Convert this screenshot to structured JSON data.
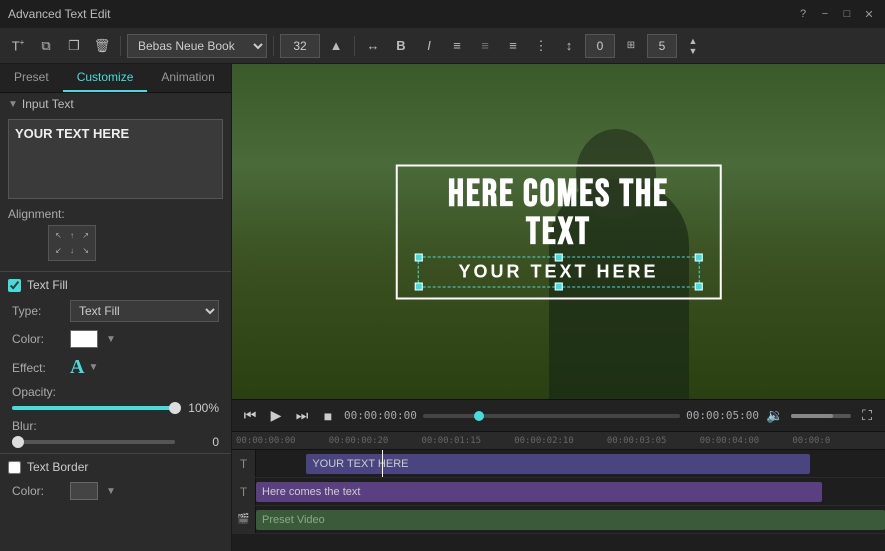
{
  "window": {
    "title": "Advanced Text Edit",
    "controls": [
      "?",
      "−",
      "□",
      "✕"
    ]
  },
  "toolbar": {
    "add_text_icon": "T+",
    "copy_icon": "⧉",
    "paste_icon": "📋",
    "delete_icon": "🗑",
    "font_name": "Bebas Neue Book",
    "font_size": "32",
    "spacing_icon": "↔",
    "bold_label": "B",
    "italic_label": "I",
    "align_left": "≡",
    "align_center": "≡",
    "align_right": "≡",
    "justify": "≡",
    "spacing2": "↕",
    "num1": "0",
    "num2": "5"
  },
  "tabs": [
    {
      "id": "preset",
      "label": "Preset"
    },
    {
      "id": "customize",
      "label": "Customize",
      "active": true
    },
    {
      "id": "animation",
      "label": "Animation"
    }
  ],
  "left_panel": {
    "input_text_section": {
      "header": "Input Text",
      "text_value": "YOUR TEXT HERE"
    },
    "alignment_section": {
      "label": "Alignment:"
    },
    "text_fill_section": {
      "checkbox_label": "Text Fill",
      "checked": true,
      "type_label": "Type:",
      "type_value": "Text Fill",
      "color_label": "Color:",
      "effect_label": "Effect:",
      "opacity_label": "Opacity:",
      "opacity_value": "100%",
      "blur_label": "Blur:",
      "blur_value": "0"
    },
    "text_border_section": {
      "checkbox_label": "Text Border",
      "checked": false,
      "color_label": "Color:"
    }
  },
  "preview": {
    "main_text": "HERE COMES THE TEXT",
    "sub_text": "YOUR TEXT HERE"
  },
  "playback": {
    "current_time": "00:00:00:00",
    "end_time": "00:00:05:00"
  },
  "timeline": {
    "ruler_marks": [
      "00:00:00:00",
      "00:00:00:20",
      "00:00:01:15",
      "00:00:02:10",
      "00:00:03:05",
      "00:00:04:00",
      "00:00:0"
    ],
    "tracks": [
      {
        "icon": "T",
        "clip_text": "YOUR TEXT HERE",
        "type": "text1"
      },
      {
        "icon": "T",
        "clip_text": "Here comes the text",
        "type": "text2"
      },
      {
        "icon": "🎬",
        "clip_text": "Preset Video",
        "type": "video"
      }
    ]
  }
}
